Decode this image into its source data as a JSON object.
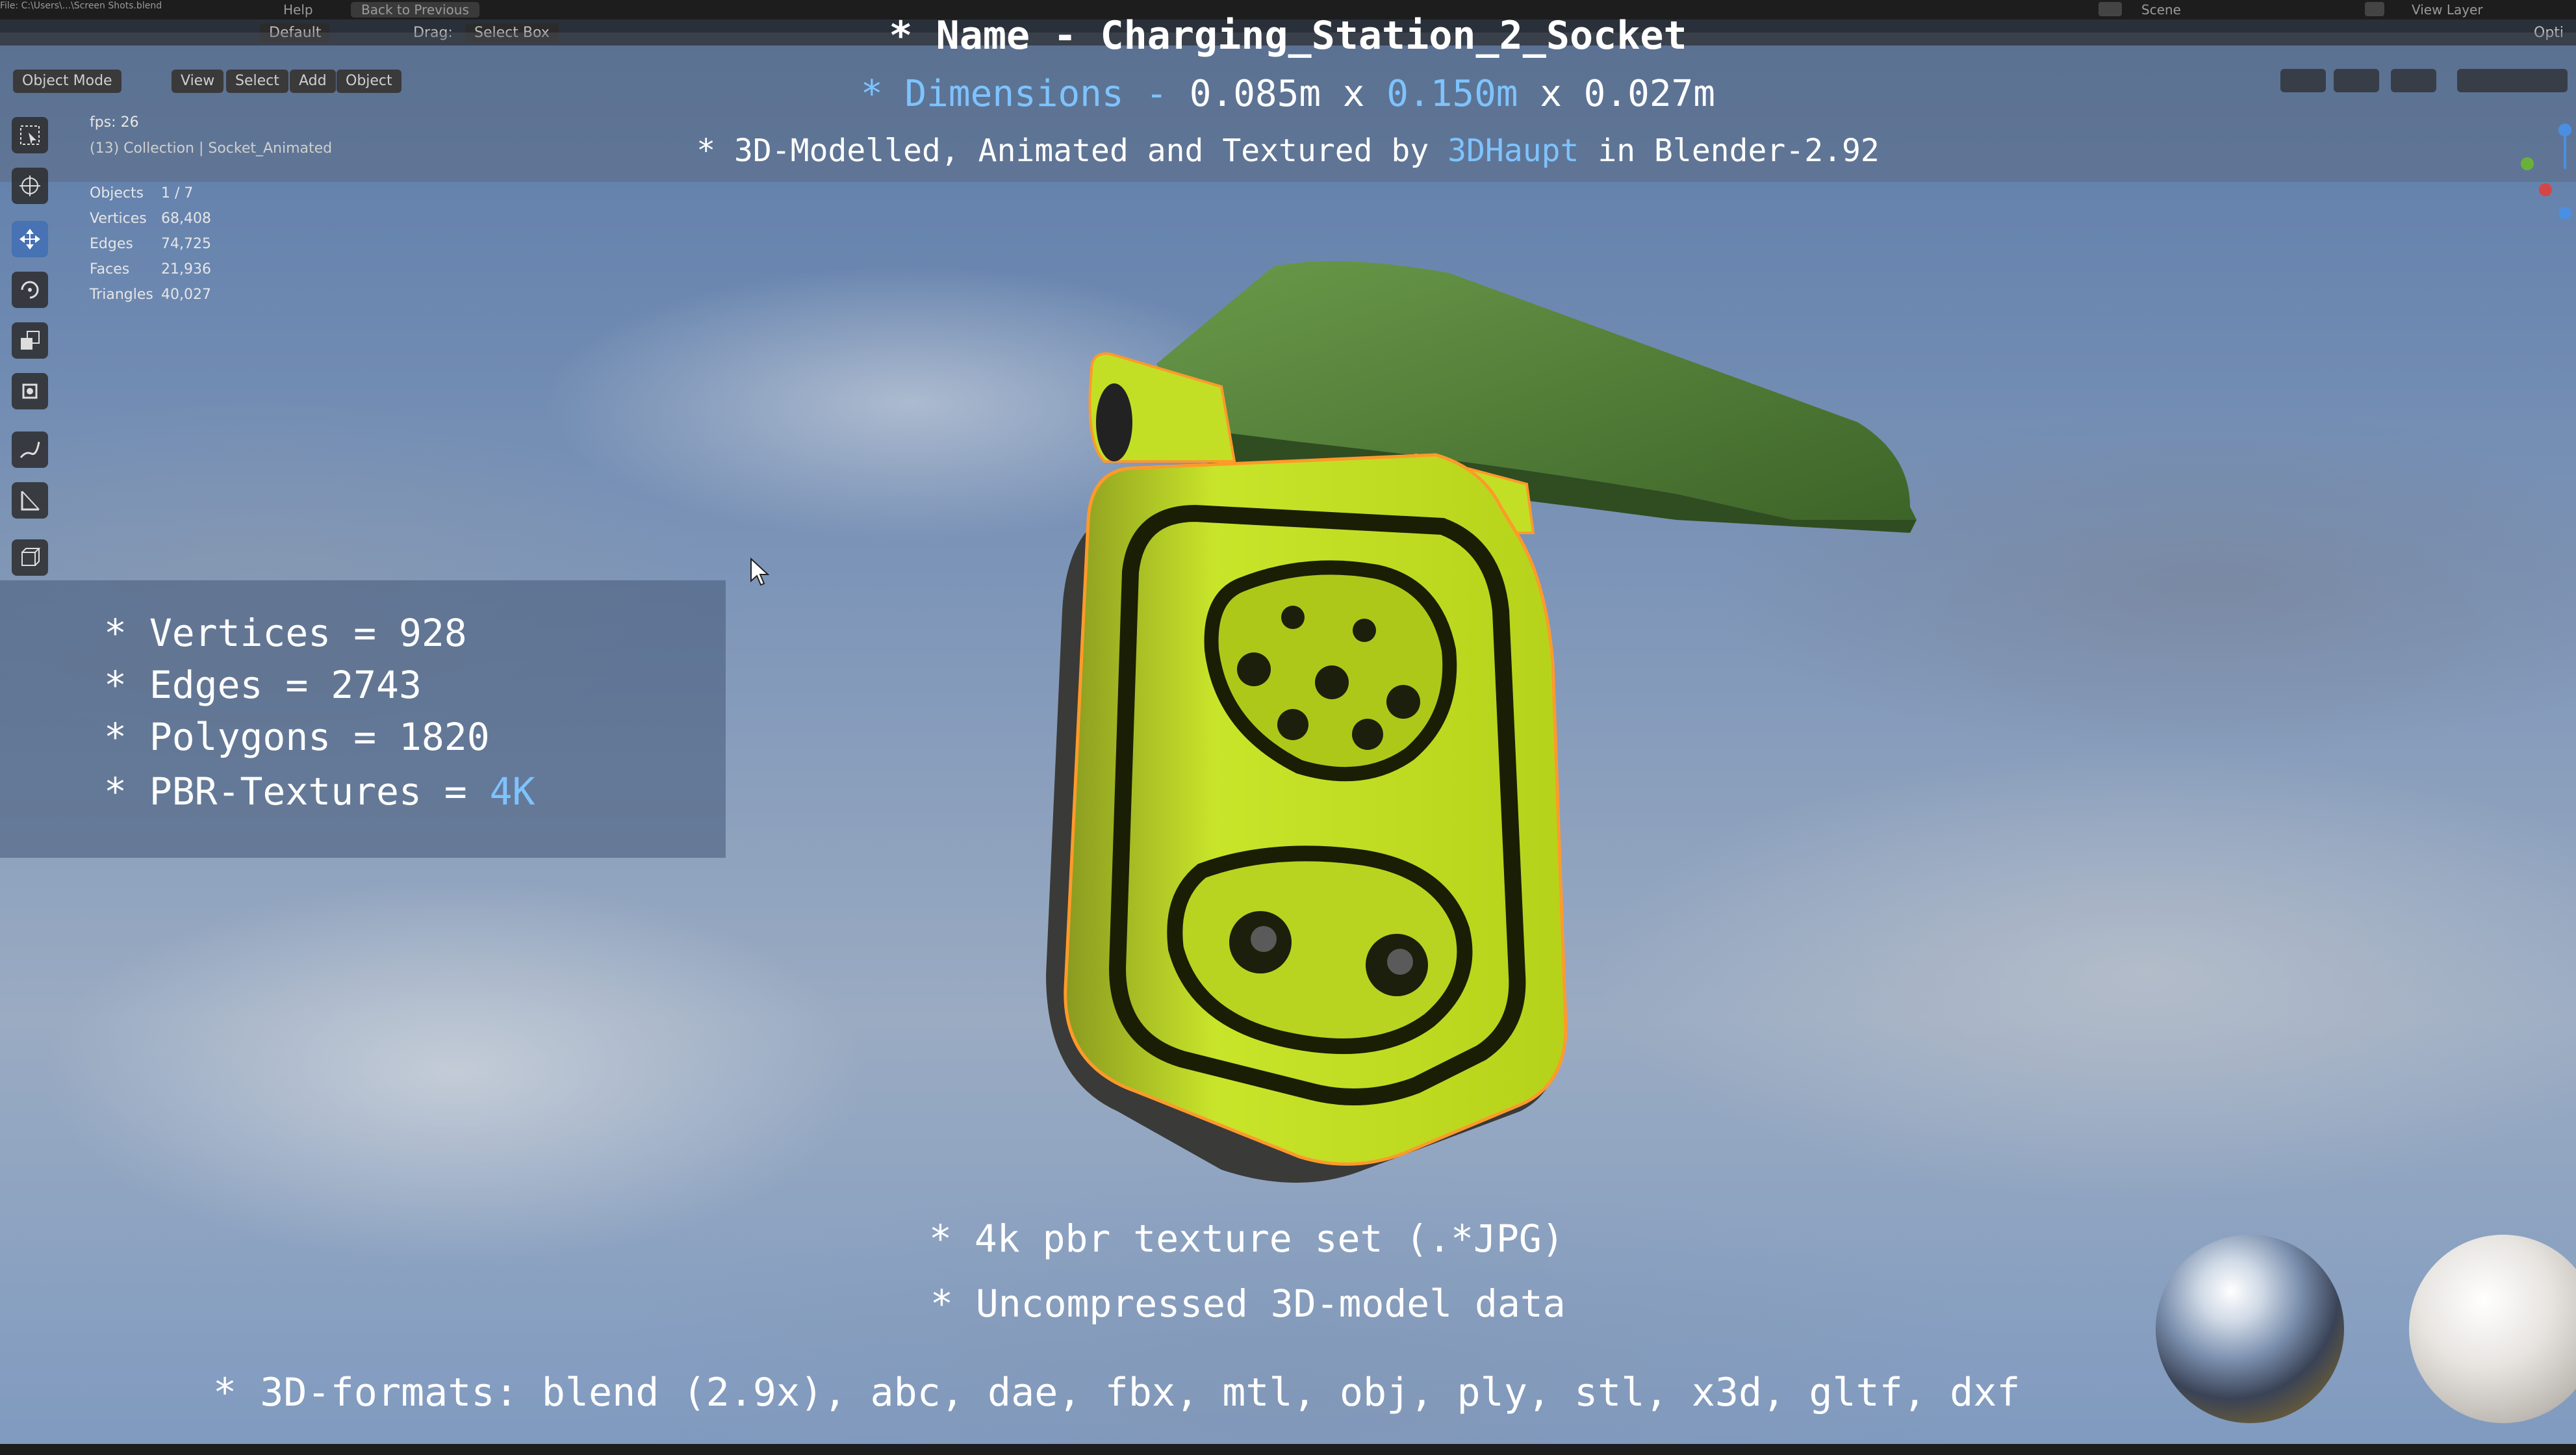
{
  "topbar": {
    "help": "Help",
    "back": "Back to Previous",
    "scene": "Scene",
    "view_layer": "View Layer",
    "opt": "Opti"
  },
  "header": {
    "orientation": "Default",
    "drag_label": "Drag:",
    "drag_value": "Select Box"
  },
  "toolbar": {
    "mode": "Object Mode",
    "view": "View",
    "select": "Select",
    "add": "Add",
    "object": "Object"
  },
  "overlay": {
    "fps": "fps: 26",
    "collection": "(13) Collection | Socket_Animated",
    "stats": [
      {
        "label": "Objects",
        "value": "1 / 7"
      },
      {
        "label": "Vertices",
        "value": "68,408"
      },
      {
        "label": "Edges",
        "value": "74,725"
      },
      {
        "label": "Faces",
        "value": "21,936"
      },
      {
        "label": "Triangles",
        "value": "40,027"
      }
    ]
  },
  "title": {
    "name_prefix": "* Name - ",
    "name": "Charging_Station_2_Socket",
    "dim_prefix": "* Dimensions - ",
    "dim_a": "0.085m",
    "dim_x1": " x ",
    "dim_b": "0.150m",
    "dim_x2": " x ",
    "dim_c": "0.027m",
    "credit_prefix": "* 3D-Modelled, Animated and Textured by ",
    "credit_author": "3DHaupt",
    "credit_suffix": " in Blender-2.92"
  },
  "specs": {
    "vertices": "* Vertices = 928",
    "edges": "* Edges = 2743",
    "polygons": "* Polygons = 1820",
    "textures_prefix": "* PBR-Textures = ",
    "textures_value": "4K"
  },
  "bottom": {
    "line1": "* 4k pbr texture set (.*JPG)",
    "line2": "* Uncompressed 3D-model data",
    "formats": "* 3D-formats: blend (2.9x), abc, dae, fbx, mtl, obj, ply, stl, x3d, gltf, dxf"
  },
  "colors": {
    "title_blue": "#7ec3ff",
    "socket_green": "#c6e21a",
    "lid_green": "#4f7f35",
    "outline": "#ff9a2a"
  }
}
